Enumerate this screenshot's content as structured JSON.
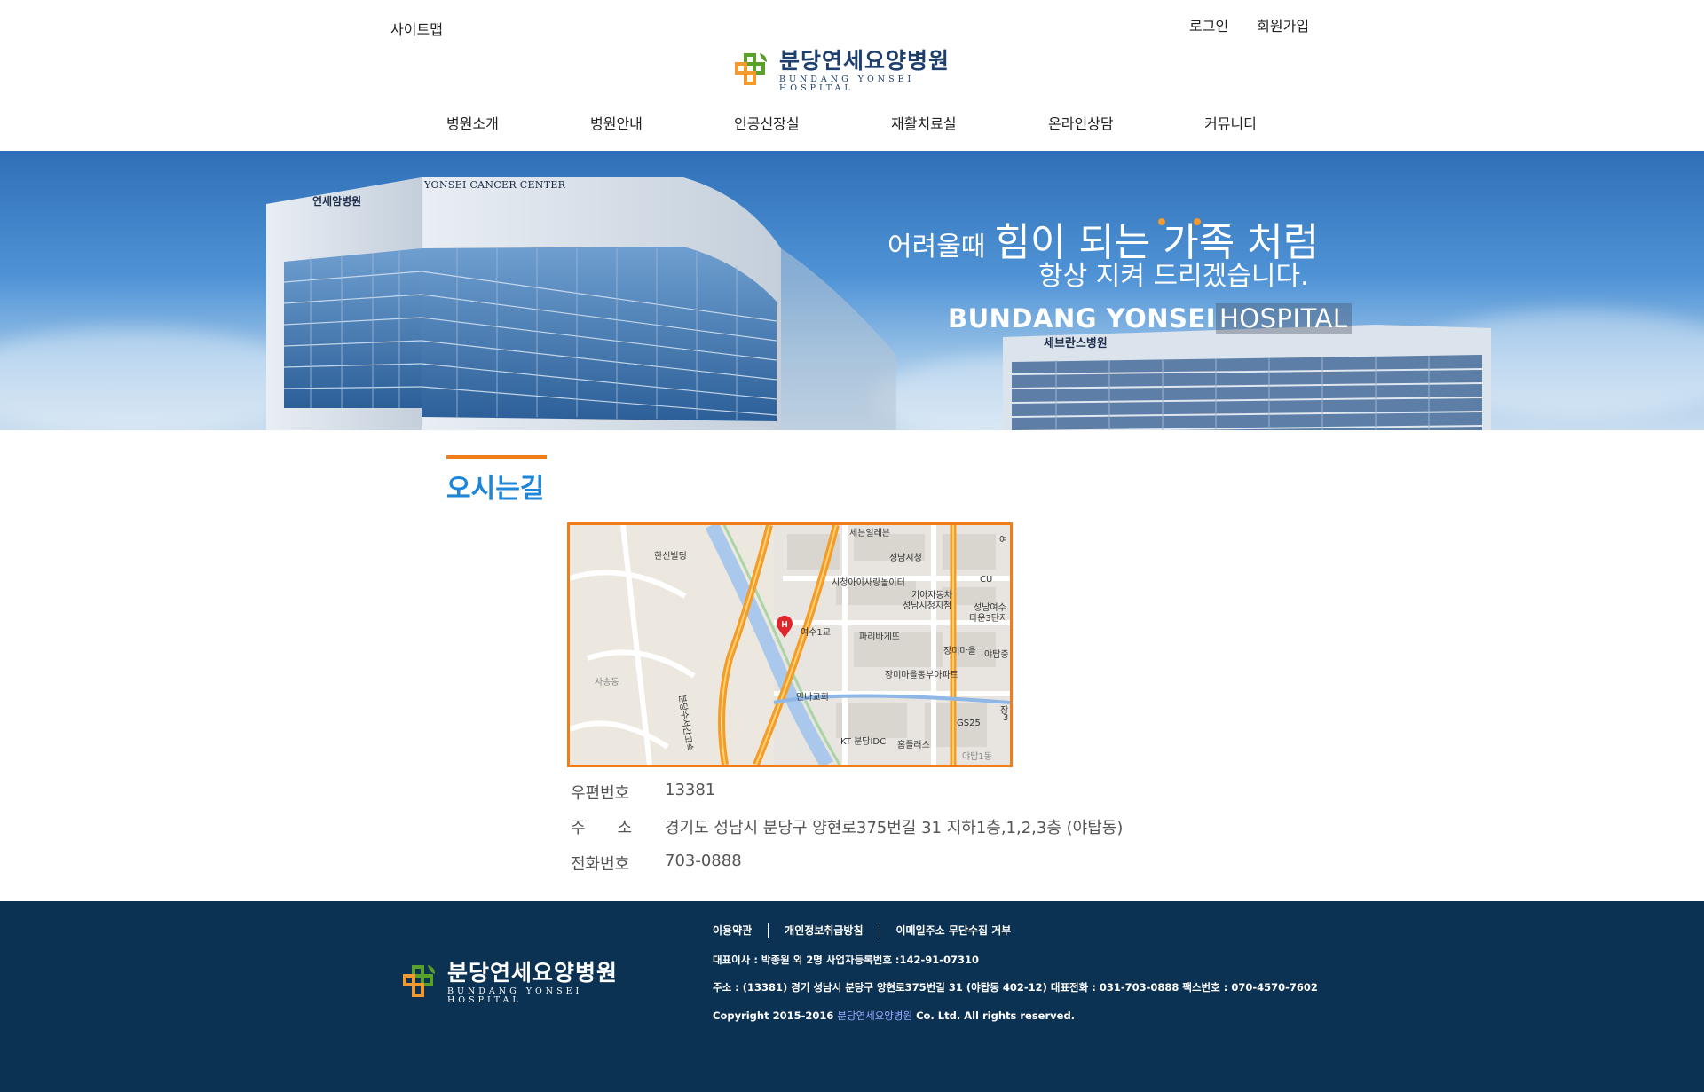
{
  "header": {
    "sitemap_label": "사이트맵",
    "login_label": "로그인",
    "signup_label": "회원가입",
    "logo": {
      "name_ko": "분당연세요양병원",
      "name_en": "BUNDANG YONSEI HOSPITAL"
    },
    "nav": [
      "병원소개",
      "병원안내",
      "인공신장실",
      "재활치료실",
      "온라인상담",
      "커뮤니티"
    ]
  },
  "banner": {
    "slogan_small": "어려울때",
    "slogan_big": "힘이 되는 가족 처럼",
    "slogan_line2": "항상 지켜 드리겠습니다.",
    "hospital_bold": "BUNDANG YONSEI",
    "hospital_light": "HOSPITAL",
    "building_sign_main": "YONSEI CANCER CENTER",
    "building_sign_logo": "연세암병원",
    "building_sign_side": "세브란스병원"
  },
  "content": {
    "title": "오시는길",
    "map_labels": {
      "hanshin": "한신빌딩",
      "seven": "세븐일레븐",
      "cityhall": "성남시청",
      "kids": "시청아이사랑놀이터",
      "cu": "CU",
      "kia": "기아자동차",
      "kia2": "성남시청지점",
      "yeosu_town": "성남여수",
      "yeosu_town2": "타운3단지",
      "yeosu_bridge": "여수1교",
      "paris": "파리바게뜨",
      "jangmi": "장미마을",
      "yatap": "야탑중",
      "songdong": "사송동",
      "jangmi_apt": "장미마을동부아파트",
      "manna": "만나교회",
      "kt": "KT 분당IDC",
      "gs25": "GS25",
      "homeplus": "홈플러스",
      "yatap1": "야탑1동",
      "highway": "분당수서간고속",
      "jang": "장",
      "three": "3",
      "yeo": "여"
    },
    "info": [
      {
        "label": "우편번호",
        "value": "13381"
      },
      {
        "label": "주　　소",
        "value": "경기도 성남시 분당구 양현로375번길 31 지하1층,1,2,3층 (야탑동)"
      },
      {
        "label": "전화번호",
        "value": "703-0888"
      }
    ]
  },
  "footer": {
    "links": [
      "이용약관",
      "개인정보취급방침",
      "이메일주소 무단수집 거부"
    ],
    "ceo_line": "대표이사 : 박종원 외 2명 사업자등록번호 :142-91-07310",
    "address_line": "주소 : (13381) 경기 성남시 분당구 양현로375번길 31 (야탑동 402-12)  대표전화 : 031-703-0888  팩스번호 : 070-4570-7602",
    "copyright_prefix": "Copyright 2015-2016",
    "copyright_name": "분당연세요양병원",
    "copyright_suffix": "Co. Ltd. All rights reserved.",
    "logo": {
      "name_ko": "분당연세요양병원",
      "name_en": "BUNDANG YONSEI HOSPITAL"
    }
  },
  "colors": {
    "accent_orange": "#f07d1a",
    "title_blue": "#1d86d8",
    "footer_navy": "#0c3253",
    "logo_green": "#5aa02c",
    "logo_orange": "#f39a2f"
  }
}
